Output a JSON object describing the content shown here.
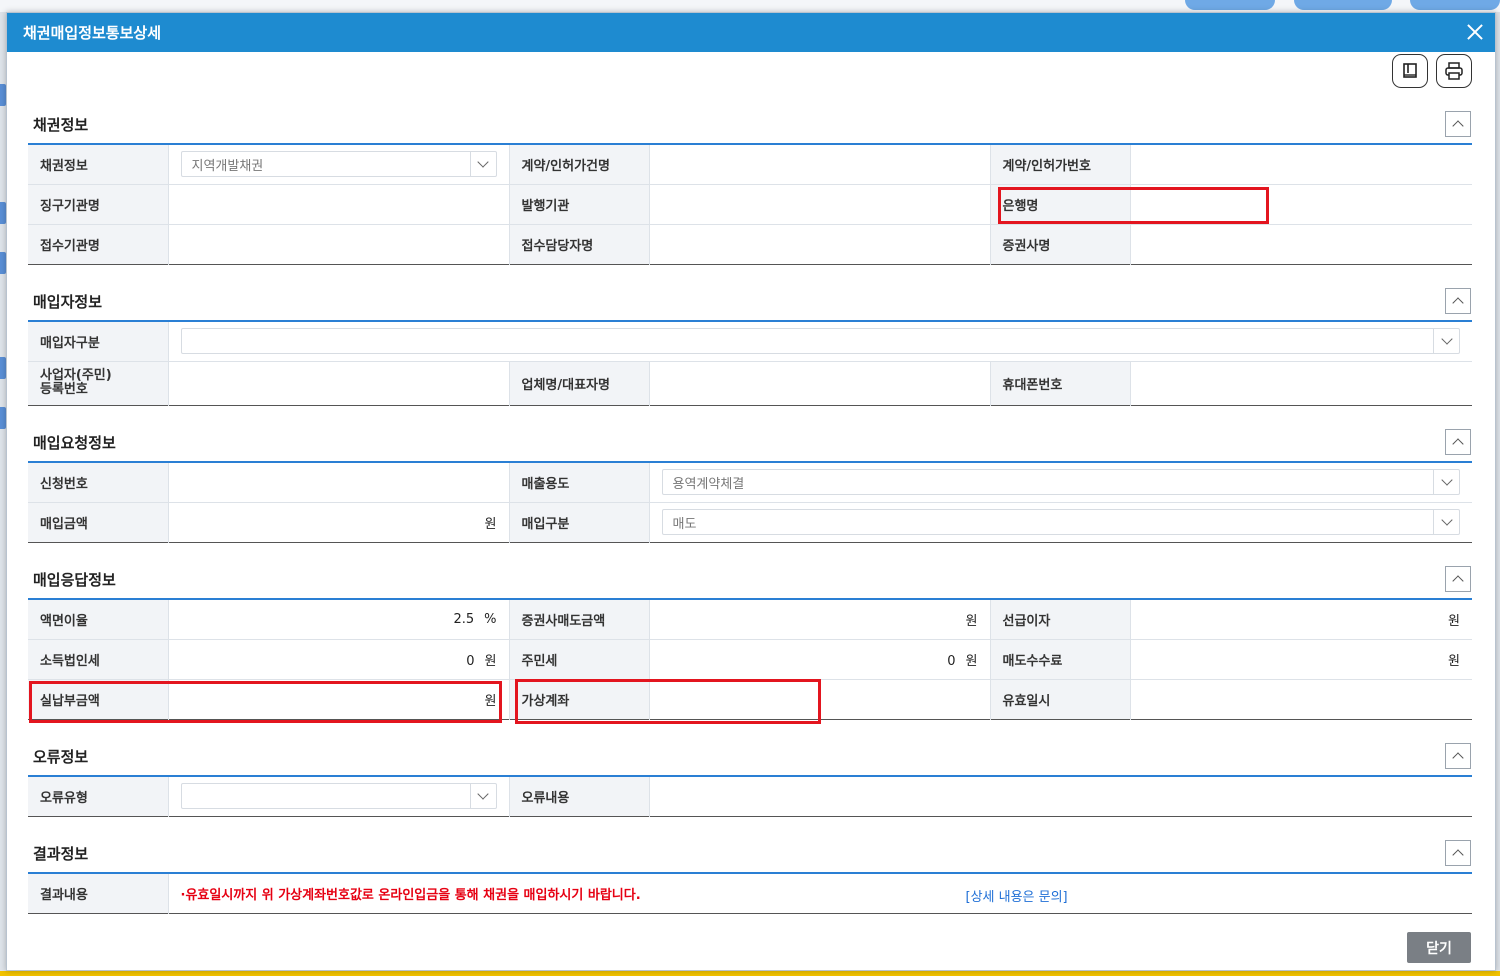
{
  "window": {
    "title": "채권매입정보통보상세"
  },
  "sections": {
    "bond": {
      "title": "채권정보",
      "labels": {
        "bond_info": "채권정보",
        "contract_name": "계약/인허가건명",
        "contract_no": "계약/인허가번호",
        "collector": "징구기관명",
        "issuer": "발행기관",
        "bank": "은행명",
        "receiver": "접수기관명",
        "receiver_staff": "접수담당자명",
        "securities": "증권사명"
      },
      "bond_info_value": "지역개발채권"
    },
    "buyer": {
      "title": "매입자정보",
      "labels": {
        "buyer_type": "매입자구분",
        "reg_no_line1": "사업자(주민)",
        "reg_no_line2": "등록번호",
        "company": "업체명/대표자명",
        "mobile": "휴대폰번호"
      }
    },
    "request": {
      "title": "매입요청정보",
      "labels": {
        "app_no": "신청번호",
        "purpose": "매출용도",
        "amount": "매입금액",
        "purchase_type": "매입구분"
      },
      "purpose_value": "용역계약체결",
      "purchase_type_value": "매도",
      "amount_unit": "원"
    },
    "response": {
      "title": "매입응답정보",
      "labels": {
        "rate": "액면이율",
        "sell_amount": "증권사매도금액",
        "advance_interest": "선급이자",
        "income_tax": "소득법인세",
        "resident_tax": "주민세",
        "sell_fee": "매도수수료",
        "net_payment": "실납부금액",
        "virtual_account": "가상계좌",
        "valid_until": "유효일시"
      },
      "rate_value": "2.5",
      "rate_unit": "%",
      "income_tax_value": "0",
      "resident_tax_value": "0",
      "won": "원"
    },
    "error": {
      "title": "오류정보",
      "labels": {
        "error_type": "오류유형",
        "error_content": "오류내용"
      }
    },
    "result": {
      "title": "결과정보",
      "labels": {
        "result_content": "결과내용"
      },
      "message": "·유효일시까지 위 가상계좌번호값로 온라인입금을 통해 채권을 매입하시기 바랍니다.",
      "detail_link": "[상세 내용은                  문의]"
    }
  },
  "footer": {
    "close_label": "닫기"
  },
  "icons": {
    "bookmark": "bookmark-icon",
    "print": "printer-icon",
    "close": "close-icon"
  },
  "colors": {
    "header": "#1e8bd0",
    "highlight": "#e3151f",
    "error_text": "#e60012",
    "link": "#1f6fd6"
  }
}
